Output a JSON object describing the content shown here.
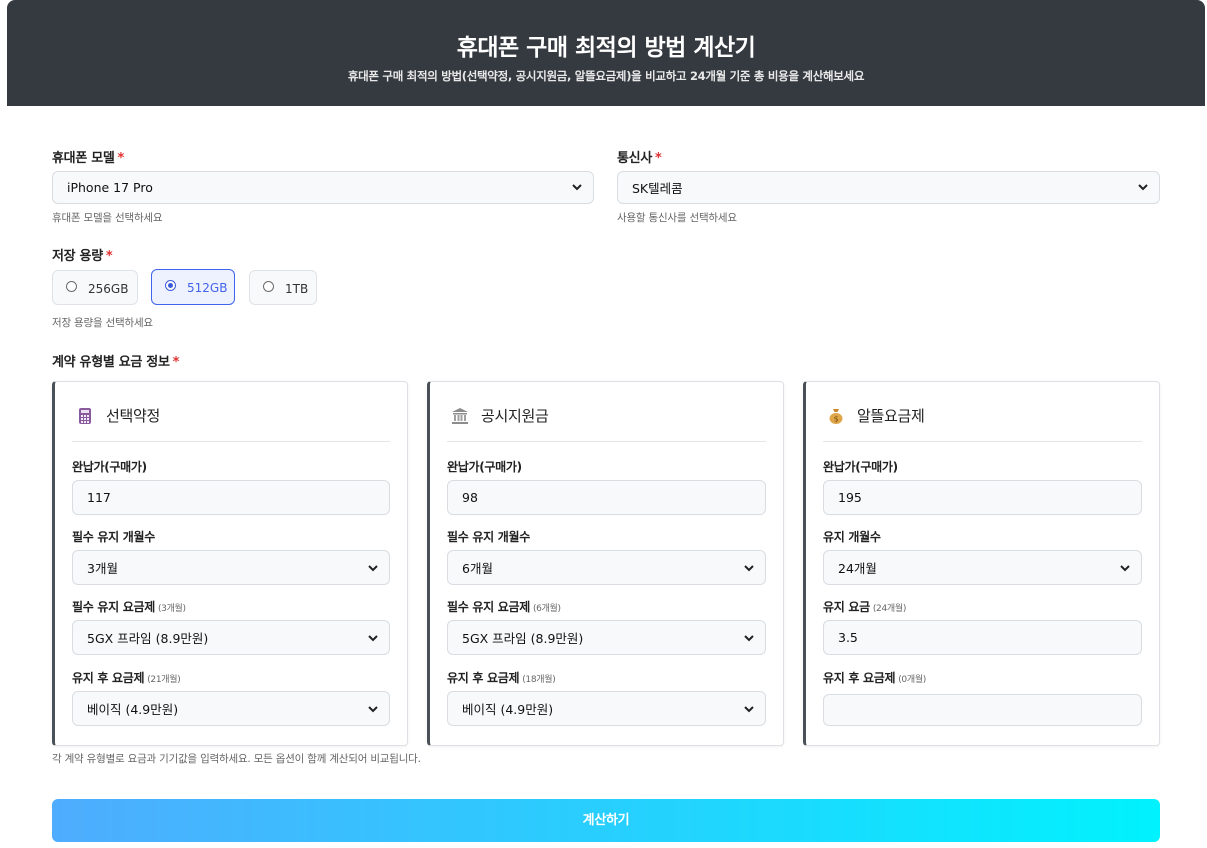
{
  "header": {
    "title": "휴대폰 구매 최적의 방법 계산기",
    "subtitle": "휴대폰 구매 최적의 방법(선택약정, 공시지원금, 알뜰요금제)을 비교하고 24개월 기준 총 비용을 계산해보세요"
  },
  "form": {
    "required_mark": "*",
    "model": {
      "label": "휴대폰 모델",
      "value": "iPhone 17 Pro",
      "help": "휴대폰 모델을 선택하세요"
    },
    "carrier": {
      "label": "통신사",
      "value": "SK텔레콤",
      "help": "사용할 통신사를 선택하세요"
    },
    "storage": {
      "label": "저장 용량",
      "options": [
        "256GB",
        "512GB",
        "1TB"
      ],
      "selected": "512GB",
      "help": "저장 용량을 선택하세요"
    },
    "plans_label": "계약 유형별 요금 정보",
    "plans_help": "각 계약 유형별로 요금과 기기값을 입력하세요. 모든 옵션이 함께 계산되어 비교됩니다."
  },
  "cards": [
    {
      "title": "선택약정",
      "icon": "calculator-icon",
      "price_label": "완납가(구매가)",
      "price_value": "117",
      "months_label": "필수 유지 개월수",
      "months_value": "3개월",
      "plan_label": "필수 유지 요금제",
      "plan_months": "(3개월)",
      "plan_value": "5GX 프라임 (8.9만원)",
      "after_label": "유지 후 요금제",
      "after_months": "(21개월)",
      "after_value": "베이직 (4.9만원)"
    },
    {
      "title": "공시지원금",
      "icon": "bank-icon",
      "price_label": "완납가(구매가)",
      "price_value": "98",
      "months_label": "필수 유지 개월수",
      "months_value": "6개월",
      "plan_label": "필수 유지 요금제",
      "plan_months": "(6개월)",
      "plan_value": "5GX 프라임 (8.9만원)",
      "after_label": "유지 후 요금제",
      "after_months": "(18개월)",
      "after_value": "베이직 (4.9만원)"
    },
    {
      "title": "알뜰요금제",
      "icon": "money-bag-icon",
      "price_label": "완납가(구매가)",
      "price_value": "195",
      "months_label": "유지 개월수",
      "months_value": "24개월",
      "plan_label": "유지 요금",
      "plan_months": "(24개월)",
      "plan_value": "3.5",
      "after_label": "유지 후 요금제",
      "after_months": "(0개월)",
      "after_value": ""
    }
  ],
  "actions": {
    "calculate": "계산하기"
  }
}
